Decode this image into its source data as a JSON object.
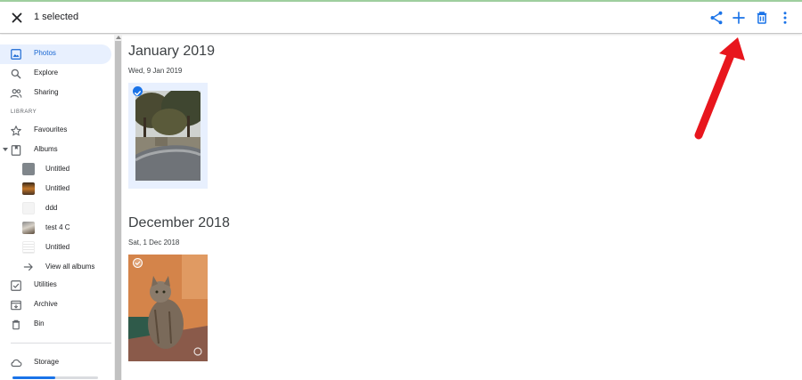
{
  "appbar": {
    "selection_text": "1 selected",
    "icons": [
      "close-icon",
      "share-icon",
      "add-icon",
      "delete-icon",
      "more-vert-icon"
    ],
    "accent_color": "#1a73e8"
  },
  "sidebar": {
    "primary": [
      {
        "label": "Photos",
        "icon": "photo-icon",
        "active": true
      },
      {
        "label": "Explore",
        "icon": "search-icon"
      },
      {
        "label": "Sharing",
        "icon": "people-icon"
      }
    ],
    "library_header": "LIBRARY",
    "favourites": {
      "label": "Favourites",
      "icon": "star-icon"
    },
    "albums": {
      "label": "Albums",
      "icon": "album-icon"
    },
    "album_items": [
      {
        "label": "Untitled",
        "thumb": "grey"
      },
      {
        "label": "Untitled",
        "thumb": "photo"
      },
      {
        "label": "ddd",
        "thumb": "blank"
      },
      {
        "label": "test 4 C",
        "thumb": "photo"
      },
      {
        "label": "Untitled",
        "thumb": "doc"
      }
    ],
    "view_all": {
      "label": "View all albums",
      "icon": "arrow-right-icon"
    },
    "utilities": {
      "label": "Utilities",
      "icon": "checklist-icon"
    },
    "archive": {
      "label": "Archive",
      "icon": "archive-icon"
    },
    "bin": {
      "label": "Bin",
      "icon": "trash-icon"
    },
    "storage": {
      "label": "Storage",
      "icon": "cloud-icon",
      "used_fraction": 0.5
    }
  },
  "main": {
    "sections": [
      {
        "title": "January 2019",
        "date": "Wed, 9 Jan 2019",
        "selected": true,
        "photo": "fountain-under-trees"
      },
      {
        "title": "December 2018",
        "date": "Sat, 1 Dec 2018",
        "selected": false,
        "photo": "tabby-cat-on-chair"
      }
    ]
  }
}
